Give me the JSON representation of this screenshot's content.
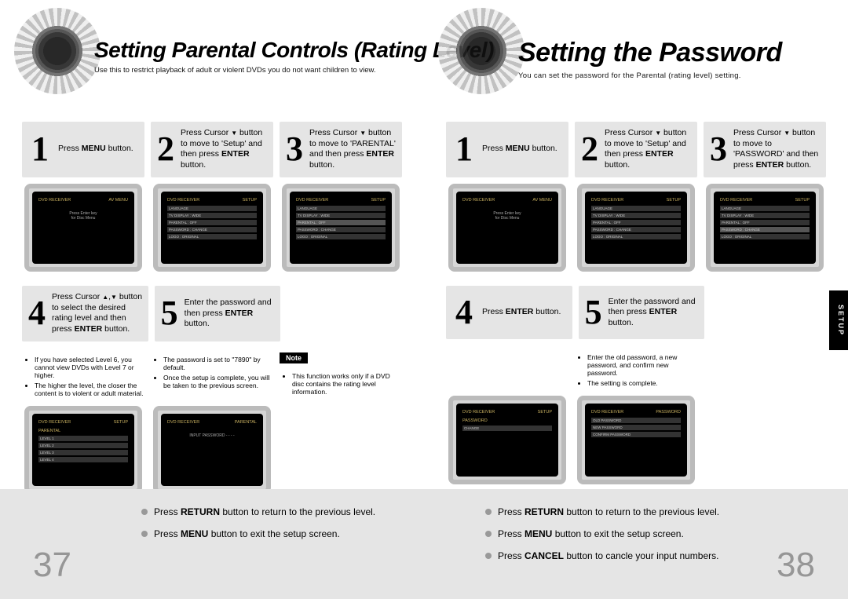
{
  "sideTab": "SETUP",
  "left": {
    "pageNumber": "37",
    "title": "Setting Parental Controls (Rating Level)",
    "subtitle": "Use this to restrict playback of adult or violent DVDs you do not want children to view.",
    "steps": {
      "s1": {
        "num": "1",
        "html": "Press <b>MENU</b> button."
      },
      "s2": {
        "num": "2",
        "html": "Press Cursor <span class='darrow'></span> button to move to 'Setup' and then press <b>ENTER</b> button."
      },
      "s3": {
        "num": "3",
        "html": "Press Cursor <span class='darrow'></span> button to move to 'PARENTAL' and then press <b>ENTER</b> button."
      },
      "s4": {
        "num": "4",
        "html": "Press Cursor <span class='uarrow'></span>,<span class='darrow'></span> button to select the desired rating level and then press <b>ENTER</b> button."
      },
      "s5": {
        "num": "5",
        "html": "Enter the password and then press <b>ENTER</b> button."
      }
    },
    "notes4": [
      "If you have selected Level 6, you cannot view DVDs with Level 7 or higher.",
      "The higher the level, the closer the content is to violent or adult material."
    ],
    "notes5": [
      "The password is set to \"7890\" by default.",
      "Once the setup is complete, you will be taken to the previous screen."
    ],
    "noteBadge": "Note",
    "noteText": "This function works only if a DVD disc contains the rating level information.",
    "bottom": [
      "Press <b>RETURN</b> button to return to the previous level.",
      "Press <b>MENU</b> button to exit the setup screen."
    ],
    "screens": {
      "s1": {
        "left": "DVD RECEIVER",
        "right": "AV MENU",
        "msg": "Press Enter key\\nfor Disc Menu"
      },
      "s2": {
        "left": "DVD RECEIVER",
        "right": "SETUP",
        "items": [
          "LANGUAGE",
          "TV DISPLAY : WIDE",
          "PARENTAL : OFF",
          "PASSWORD : CHANGE",
          "LOGO : ORIGINAL"
        ]
      },
      "s3": {
        "left": "DVD RECEIVER",
        "right": "SETUP",
        "items": [
          "LANGUAGE",
          "TV DISPLAY : WIDE",
          "PARENTAL : OFF",
          "PASSWORD : CHANGE",
          "LOGO : ORIGINAL"
        ],
        "hl": 2
      },
      "s4": {
        "left": "DVD RECEIVER",
        "right": "SETUP",
        "sel": "PARENTAL",
        "items": [
          "LEVEL 1",
          "LEVEL 2",
          "LEVEL 3",
          "LEVEL 4"
        ]
      },
      "s5": {
        "left": "DVD RECEIVER",
        "right": "PARENTAL",
        "msg": "INPUT PASSWORD  - - - -"
      }
    }
  },
  "right": {
    "pageNumber": "38",
    "title": "Setting the Password",
    "subtitle": "You can set the password for the Parental (rating level) setting.",
    "steps": {
      "s1": {
        "num": "1",
        "html": "Press <b>MENU</b> button."
      },
      "s2": {
        "num": "2",
        "html": "Press Cursor <span class='darrow'></span> button to move to 'Setup' and then press <b>ENTER</b> button."
      },
      "s3": {
        "num": "3",
        "html": "Press Cursor <span class='darrow'></span> button to move to 'PASSWORD' and then press <b>ENTER</b> button."
      },
      "s4": {
        "num": "4",
        "html": "Press <b>ENTER</b> button."
      },
      "s5": {
        "num": "5",
        "html": "Enter the password and then press <b>ENTER</b> button."
      }
    },
    "notes5": [
      "Enter the old password, a new password, and confirm new password.",
      "The setting is complete."
    ],
    "bottom": [
      "Press <b>RETURN</b> button to return to the previous level.",
      "Press <b>MENU</b> button to exit the setup screen.",
      "Press <b>CANCEL</b> button to cancle your input numbers."
    ],
    "screens": {
      "s1": {
        "left": "DVD RECEIVER",
        "right": "AV MENU",
        "msg": "Press Enter key\\nfor Disc Menu"
      },
      "s2": {
        "left": "DVD RECEIVER",
        "right": "SETUP",
        "items": [
          "LANGUAGE",
          "TV DISPLAY : WIDE",
          "PARENTAL : OFF",
          "PASSWORD : CHANGE",
          "LOGO : ORIGINAL"
        ]
      },
      "s3": {
        "left": "DVD RECEIVER",
        "right": "SETUP",
        "items": [
          "LANGUAGE",
          "TV DISPLAY : WIDE",
          "PARENTAL : OFF",
          "PASSWORD : CHANGE",
          "LOGO : ORIGINAL"
        ],
        "hl": 3
      },
      "s4": {
        "left": "DVD RECEIVER",
        "right": "SETUP",
        "sel": "PASSWORD",
        "items": [
          "CHANGE"
        ]
      },
      "s5": {
        "left": "DVD RECEIVER",
        "right": "PASSWORD",
        "items": [
          "OLD PASSWORD",
          "NEW PASSWORD",
          "CONFIRM PASSWORD"
        ]
      }
    }
  }
}
